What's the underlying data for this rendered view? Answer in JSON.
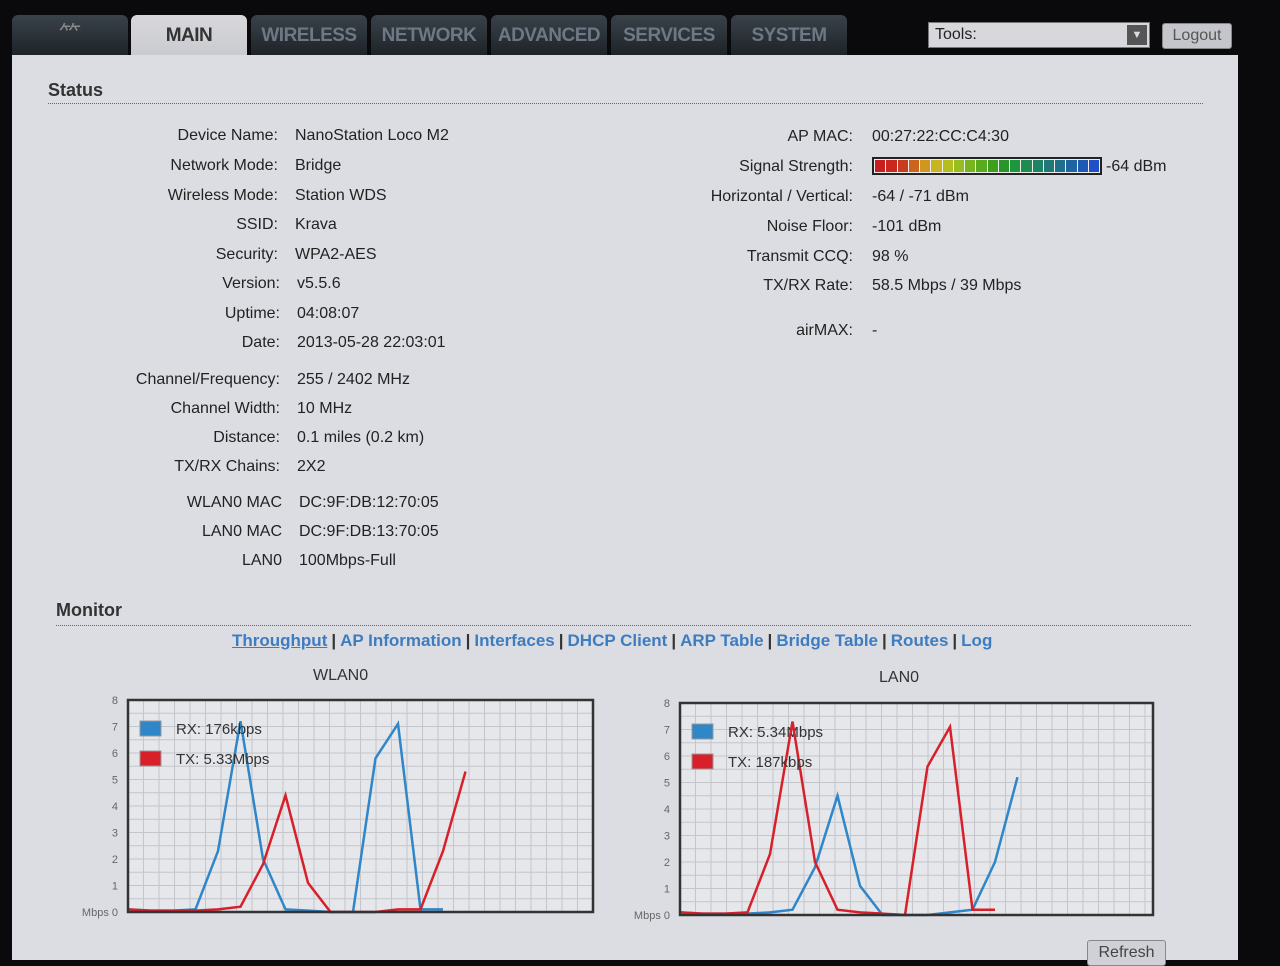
{
  "nav": {
    "logo": "ubiquiti-logo",
    "tabs": [
      "MAIN",
      "WIRELESS",
      "NETWORK",
      "ADVANCED",
      "SERVICES",
      "SYSTEM"
    ],
    "active": "MAIN",
    "tools_label": "Tools:",
    "logout": "Logout"
  },
  "status": {
    "title": "Status",
    "left": [
      [
        "Device Name:",
        "NanoStation Loco M2"
      ],
      [
        "Network Mode:",
        "Bridge"
      ],
      [
        "Wireless Mode:",
        "Station WDS"
      ],
      [
        "SSID:",
        "Krava"
      ],
      [
        "Security:",
        "WPA2-AES"
      ],
      [
        "Version:",
        "v5.5.6"
      ],
      [
        "Uptime:",
        "04:08:07"
      ],
      [
        "Date:",
        "2013-05-28 22:03:01"
      ],
      [
        "Channel/Frequency:",
        "255 / 2402 MHz"
      ],
      [
        "Channel Width:",
        "10 MHz"
      ],
      [
        "Distance:",
        "0.1 miles (0.2 km)"
      ],
      [
        "TX/RX Chains:",
        "2X2"
      ],
      [
        "WLAN0 MAC",
        "DC:9F:DB:12:70:05"
      ],
      [
        "LAN0 MAC",
        "DC:9F:DB:13:70:05"
      ],
      [
        "LAN0",
        "100Mbps-Full"
      ]
    ],
    "right": [
      [
        "AP MAC:",
        "00:27:22:CC:C4:30"
      ],
      [
        "Signal Strength:",
        "-64 dBm"
      ],
      [
        "Horizontal / Vertical:",
        "-64 / -71 dBm"
      ],
      [
        "Noise Floor:",
        "-101 dBm"
      ],
      [
        "Transmit CCQ:",
        "98 %"
      ],
      [
        "TX/RX Rate:",
        "58.5 Mbps / 39 Mbps"
      ],
      [
        "airMAX:",
        "-"
      ]
    ],
    "signal_fill": 1.0
  },
  "monitor": {
    "title": "Monitor",
    "links": [
      "Throughput",
      "AP Information",
      "Interfaces",
      "DHCP Client",
      "ARP Table",
      "Bridge Table",
      "Routes",
      "Log"
    ],
    "refresh": "Refresh"
  },
  "chart_data": [
    {
      "type": "line",
      "title": "WLAN0",
      "ylabel": "Mbps",
      "ylim": [
        0,
        8
      ],
      "yticks": [
        "Mbps 0",
        "1",
        "2",
        "3",
        "4",
        "5",
        "6",
        "7",
        "8"
      ],
      "series": [
        {
          "name": "RX: 176kbps",
          "color": "#2f86c8",
          "values": [
            0.1,
            0.05,
            0.05,
            0.1,
            2.3,
            7.2,
            2.0,
            0.1,
            0.05,
            0,
            0,
            5.8,
            7.1,
            0.1,
            0.1
          ]
        },
        {
          "name": "TX: 5.33Mbps",
          "color": "#d8202a",
          "values": [
            0.1,
            0.05,
            0.05,
            0.05,
            0.1,
            0.2,
            1.8,
            4.4,
            1.1,
            0,
            0,
            0,
            0.1,
            0.1,
            2.3,
            5.3
          ]
        }
      ]
    },
    {
      "type": "line",
      "title": "LAN0",
      "ylabel": "Mbps",
      "ylim": [
        0,
        8
      ],
      "yticks": [
        "Mbps 0",
        "1",
        "2",
        "3",
        "4",
        "5",
        "6",
        "7",
        "8"
      ],
      "series": [
        {
          "name": "RX: 5.34Mbps",
          "color": "#2f86c8",
          "values": [
            0.1,
            0.05,
            0.05,
            0.05,
            0.1,
            0.2,
            1.8,
            4.5,
            1.1,
            0,
            0,
            0,
            0.1,
            0.2,
            2.0,
            5.2
          ]
        },
        {
          "name": "TX: 187kbps",
          "color": "#d8202a",
          "values": [
            0.1,
            0.05,
            0.05,
            0.1,
            2.3,
            7.3,
            2.0,
            0.2,
            0.1,
            0.05,
            0,
            5.6,
            7.1,
            0.2,
            0.2
          ]
        }
      ]
    }
  ]
}
